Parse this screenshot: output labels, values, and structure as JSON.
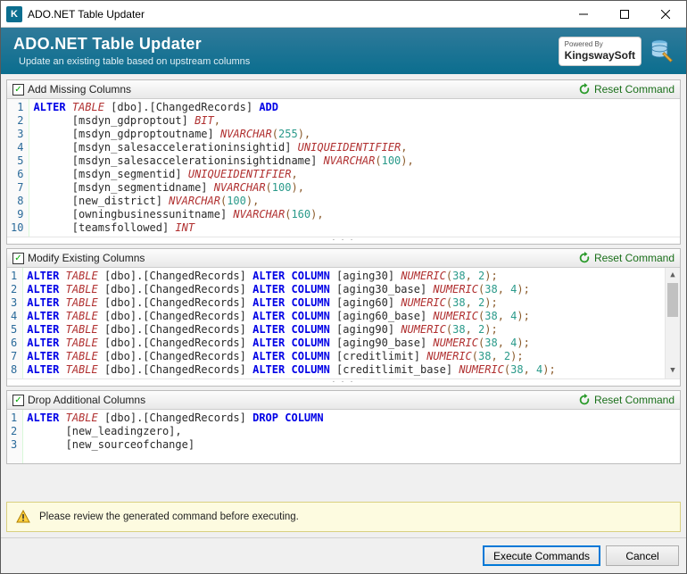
{
  "window": {
    "title": "ADO.NET Table Updater",
    "icon_letter": "K"
  },
  "header": {
    "title": "ADO.NET Table Updater",
    "subtitle": "Update an existing table based on upstream columns",
    "brand_top": "Powered By",
    "brand_name": "KingswaySoft"
  },
  "reset_label": "Reset Command",
  "panels": {
    "add": {
      "title": "Add Missing Columns",
      "checked": true,
      "lines": [
        [
          [
            "kw-blue",
            "ALTER"
          ],
          [
            "plain",
            " "
          ],
          [
            "kw-red",
            "TABLE"
          ],
          [
            "plain",
            " [dbo].[ChangedRecords] "
          ],
          [
            "kw-blue",
            "ADD"
          ]
        ],
        [
          [
            "plain",
            "      [msdyn_gdproptout] "
          ],
          [
            "kw-red",
            "BIT"
          ],
          [
            "tk-brown",
            ","
          ]
        ],
        [
          [
            "plain",
            "      [msdyn_gdproptoutname] "
          ],
          [
            "kw-red",
            "NVARCHAR"
          ],
          [
            "tk-brown",
            "("
          ],
          [
            "tk-teal",
            "255"
          ],
          [
            "tk-brown",
            "),"
          ]
        ],
        [
          [
            "plain",
            "      [msdyn_salesaccelerationinsightid] "
          ],
          [
            "kw-red",
            "UNIQUEIDENTIFIER"
          ],
          [
            "tk-brown",
            ","
          ]
        ],
        [
          [
            "plain",
            "      [msdyn_salesaccelerationinsightidname] "
          ],
          [
            "kw-red",
            "NVARCHAR"
          ],
          [
            "tk-brown",
            "("
          ],
          [
            "tk-teal",
            "100"
          ],
          [
            "tk-brown",
            "),"
          ]
        ],
        [
          [
            "plain",
            "      [msdyn_segmentid] "
          ],
          [
            "kw-red",
            "UNIQUEIDENTIFIER"
          ],
          [
            "tk-brown",
            ","
          ]
        ],
        [
          [
            "plain",
            "      [msdyn_segmentidname] "
          ],
          [
            "kw-red",
            "NVARCHAR"
          ],
          [
            "tk-brown",
            "("
          ],
          [
            "tk-teal",
            "100"
          ],
          [
            "tk-brown",
            "),"
          ]
        ],
        [
          [
            "plain",
            "      [new_district] "
          ],
          [
            "kw-red",
            "NVARCHAR"
          ],
          [
            "tk-brown",
            "("
          ],
          [
            "tk-teal",
            "100"
          ],
          [
            "tk-brown",
            "),"
          ]
        ],
        [
          [
            "plain",
            "      [owningbusinessunitname] "
          ],
          [
            "kw-red",
            "NVARCHAR"
          ],
          [
            "tk-brown",
            "("
          ],
          [
            "tk-teal",
            "160"
          ],
          [
            "tk-brown",
            "),"
          ]
        ],
        [
          [
            "plain",
            "      [teamsfollowed] "
          ],
          [
            "kw-red",
            "INT"
          ]
        ]
      ]
    },
    "modify": {
      "title": "Modify Existing Columns",
      "checked": true,
      "lines": [
        [
          [
            "kw-blue",
            "ALTER"
          ],
          [
            "plain",
            " "
          ],
          [
            "kw-red",
            "TABLE"
          ],
          [
            "plain",
            " [dbo].[ChangedRecords] "
          ],
          [
            "kw-blue",
            "ALTER"
          ],
          [
            "plain",
            " "
          ],
          [
            "kw-blue",
            "COLUMN"
          ],
          [
            "plain",
            " [aging30] "
          ],
          [
            "kw-red",
            "NUMERIC"
          ],
          [
            "tk-brown",
            "("
          ],
          [
            "tk-teal",
            "38"
          ],
          [
            "tk-brown",
            ", "
          ],
          [
            "tk-teal",
            "2"
          ],
          [
            "tk-brown",
            ");"
          ]
        ],
        [
          [
            "kw-blue",
            "ALTER"
          ],
          [
            "plain",
            " "
          ],
          [
            "kw-red",
            "TABLE"
          ],
          [
            "plain",
            " [dbo].[ChangedRecords] "
          ],
          [
            "kw-blue",
            "ALTER"
          ],
          [
            "plain",
            " "
          ],
          [
            "kw-blue",
            "COLUMN"
          ],
          [
            "plain",
            " [aging30_base] "
          ],
          [
            "kw-red",
            "NUMERIC"
          ],
          [
            "tk-brown",
            "("
          ],
          [
            "tk-teal",
            "38"
          ],
          [
            "tk-brown",
            ", "
          ],
          [
            "tk-teal",
            "4"
          ],
          [
            "tk-brown",
            ");"
          ]
        ],
        [
          [
            "kw-blue",
            "ALTER"
          ],
          [
            "plain",
            " "
          ],
          [
            "kw-red",
            "TABLE"
          ],
          [
            "plain",
            " [dbo].[ChangedRecords] "
          ],
          [
            "kw-blue",
            "ALTER"
          ],
          [
            "plain",
            " "
          ],
          [
            "kw-blue",
            "COLUMN"
          ],
          [
            "plain",
            " [aging60] "
          ],
          [
            "kw-red",
            "NUMERIC"
          ],
          [
            "tk-brown",
            "("
          ],
          [
            "tk-teal",
            "38"
          ],
          [
            "tk-brown",
            ", "
          ],
          [
            "tk-teal",
            "2"
          ],
          [
            "tk-brown",
            ");"
          ]
        ],
        [
          [
            "kw-blue",
            "ALTER"
          ],
          [
            "plain",
            " "
          ],
          [
            "kw-red",
            "TABLE"
          ],
          [
            "plain",
            " [dbo].[ChangedRecords] "
          ],
          [
            "kw-blue",
            "ALTER"
          ],
          [
            "plain",
            " "
          ],
          [
            "kw-blue",
            "COLUMN"
          ],
          [
            "plain",
            " [aging60_base] "
          ],
          [
            "kw-red",
            "NUMERIC"
          ],
          [
            "tk-brown",
            "("
          ],
          [
            "tk-teal",
            "38"
          ],
          [
            "tk-brown",
            ", "
          ],
          [
            "tk-teal",
            "4"
          ],
          [
            "tk-brown",
            ");"
          ]
        ],
        [
          [
            "kw-blue",
            "ALTER"
          ],
          [
            "plain",
            " "
          ],
          [
            "kw-red",
            "TABLE"
          ],
          [
            "plain",
            " [dbo].[ChangedRecords] "
          ],
          [
            "kw-blue",
            "ALTER"
          ],
          [
            "plain",
            " "
          ],
          [
            "kw-blue",
            "COLUMN"
          ],
          [
            "plain",
            " [aging90] "
          ],
          [
            "kw-red",
            "NUMERIC"
          ],
          [
            "tk-brown",
            "("
          ],
          [
            "tk-teal",
            "38"
          ],
          [
            "tk-brown",
            ", "
          ],
          [
            "tk-teal",
            "2"
          ],
          [
            "tk-brown",
            ");"
          ]
        ],
        [
          [
            "kw-blue",
            "ALTER"
          ],
          [
            "plain",
            " "
          ],
          [
            "kw-red",
            "TABLE"
          ],
          [
            "plain",
            " [dbo].[ChangedRecords] "
          ],
          [
            "kw-blue",
            "ALTER"
          ],
          [
            "plain",
            " "
          ],
          [
            "kw-blue",
            "COLUMN"
          ],
          [
            "plain",
            " [aging90_base] "
          ],
          [
            "kw-red",
            "NUMERIC"
          ],
          [
            "tk-brown",
            "("
          ],
          [
            "tk-teal",
            "38"
          ],
          [
            "tk-brown",
            ", "
          ],
          [
            "tk-teal",
            "4"
          ],
          [
            "tk-brown",
            ");"
          ]
        ],
        [
          [
            "kw-blue",
            "ALTER"
          ],
          [
            "plain",
            " "
          ],
          [
            "kw-red",
            "TABLE"
          ],
          [
            "plain",
            " [dbo].[ChangedRecords] "
          ],
          [
            "kw-blue",
            "ALTER"
          ],
          [
            "plain",
            " "
          ],
          [
            "kw-blue",
            "COLUMN"
          ],
          [
            "plain",
            " [creditlimit] "
          ],
          [
            "kw-red",
            "NUMERIC"
          ],
          [
            "tk-brown",
            "("
          ],
          [
            "tk-teal",
            "38"
          ],
          [
            "tk-brown",
            ", "
          ],
          [
            "tk-teal",
            "2"
          ],
          [
            "tk-brown",
            ");"
          ]
        ],
        [
          [
            "kw-blue",
            "ALTER"
          ],
          [
            "plain",
            " "
          ],
          [
            "kw-red",
            "TABLE"
          ],
          [
            "plain",
            " [dbo].[ChangedRecords] "
          ],
          [
            "kw-blue",
            "ALTER"
          ],
          [
            "plain",
            " "
          ],
          [
            "kw-blue",
            "COLUMN"
          ],
          [
            "plain",
            " [creditlimit_base] "
          ],
          [
            "kw-red",
            "NUMERIC"
          ],
          [
            "tk-brown",
            "("
          ],
          [
            "tk-teal",
            "38"
          ],
          [
            "tk-brown",
            ", "
          ],
          [
            "tk-teal",
            "4"
          ],
          [
            "tk-brown",
            ");"
          ]
        ]
      ]
    },
    "drop": {
      "title": "Drop Additional Columns",
      "checked": true,
      "lines": [
        [
          [
            "kw-blue",
            "ALTER"
          ],
          [
            "plain",
            " "
          ],
          [
            "kw-red",
            "TABLE"
          ],
          [
            "plain",
            " [dbo].[ChangedRecords] "
          ],
          [
            "kw-blue",
            "DROP"
          ],
          [
            "plain",
            " "
          ],
          [
            "kw-blue",
            "COLUMN"
          ]
        ],
        [
          [
            "plain",
            "      [new_leadingzero],"
          ]
        ],
        [
          [
            "plain",
            "      [new_sourceofchange]"
          ]
        ]
      ]
    }
  },
  "warning": "Please review the generated command before executing.",
  "buttons": {
    "execute": "Execute Commands",
    "cancel": "Cancel"
  }
}
